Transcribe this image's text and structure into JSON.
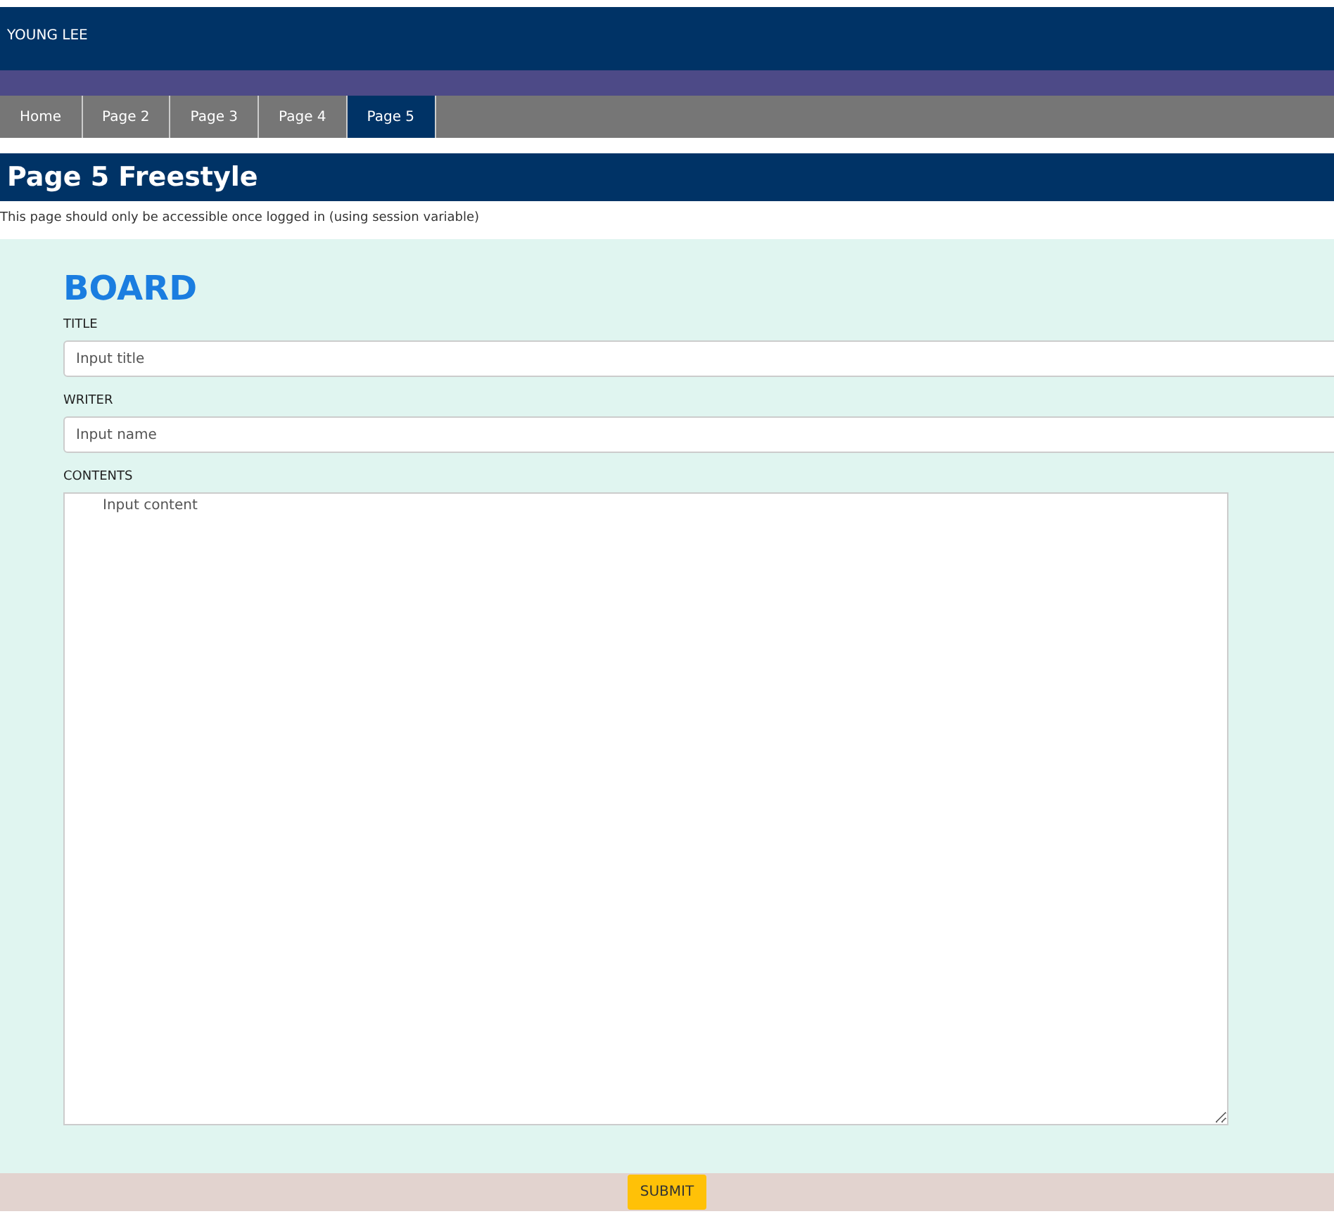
{
  "header": {
    "user": "YOUNG LEE"
  },
  "nav": [
    {
      "label": "Home",
      "selected": false
    },
    {
      "label": "Page 2",
      "selected": false
    },
    {
      "label": "Page 3",
      "selected": false
    },
    {
      "label": "Page 4",
      "selected": false
    },
    {
      "label": "Page 5",
      "selected": true
    }
  ],
  "page_title": "Page 5 Freestyle",
  "note": "This page should only be accessible once logged in (using session variable)",
  "board": {
    "heading": "BOARD",
    "fields": [
      {
        "label": "TITLE",
        "placeholder": "Input title",
        "kind": "line"
      },
      {
        "label": "WRITER",
        "placeholder": "Input name",
        "kind": "line"
      },
      {
        "label": "CONTENTS",
        "placeholder": "Input content",
        "kind": "area"
      }
    ]
  },
  "submit": "SUBMIT"
}
